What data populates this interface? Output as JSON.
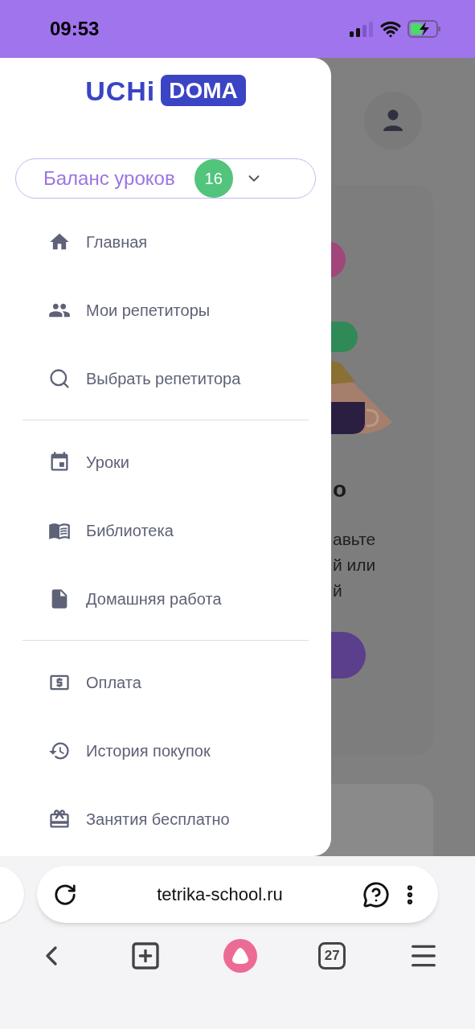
{
  "status_bar": {
    "time": "09:53"
  },
  "logo": {
    "text_1": "UCHi",
    "text_2": "DOMA"
  },
  "balance": {
    "label": "Баланс уроков",
    "count": "16",
    "expanded": false
  },
  "menu": [
    [
      {
        "label": "Главная"
      },
      {
        "label": "Мои репетиторы"
      },
      {
        "label": "Выбрать репетитора"
      }
    ],
    [
      {
        "label": "Уроки"
      },
      {
        "label": "Библиотека"
      },
      {
        "label": "Домашняя работа"
      }
    ],
    [
      {
        "label": "Оплата"
      },
      {
        "label": "История покупок"
      },
      {
        "label": "Занятия бесплатно"
      }
    ]
  ],
  "background_page": {
    "heading": "о",
    "text_lines": [
      "авьте",
      "й или",
      "й"
    ]
  },
  "browser": {
    "url": "tetrika-school.ru",
    "tabs_count": "27"
  }
}
